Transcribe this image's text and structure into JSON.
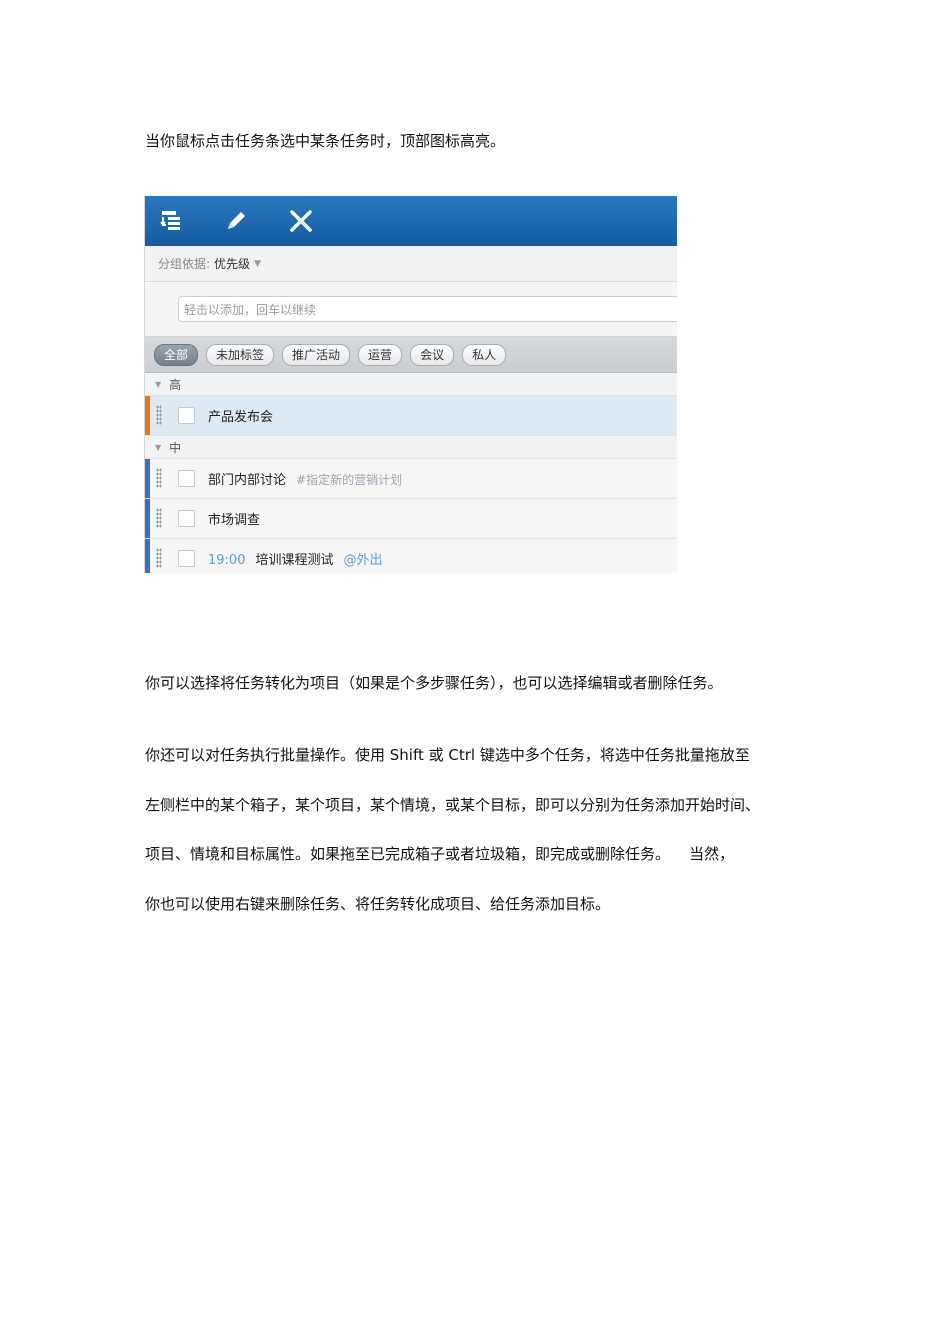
{
  "paragraphs": {
    "p1": "当你鼠标点击任务条选中某条任务时，顶部图标高亮。",
    "p2": "你可以选择将任务转化为项目（如果是个多步骤任务），也可以选择编辑或者删除任务。",
    "p3_l1": "你还可以对任务执行批量操作。使用 Shift 或 Ctrl 键选中多个任务，将选中任务批量拖放至",
    "p3_l2": "左侧栏中的某个箱子，某个项目，某个情境，或某个目标，即可以分别为任务添加开始时间、",
    "p3_l3": "项目、情境和目标属性。如果拖至已完成箱子或者垃圾箱，即完成或删除任务。    当然，",
    "p3_l4": "你也可以使用右键来删除任务、将任务转化成项目、给任务添加目标。"
  },
  "app": {
    "toolbar": {
      "icons": [
        "convert-to-project-icon",
        "edit-pencil-icon",
        "delete-x-icon"
      ]
    },
    "groupby": {
      "label": "分组依据:",
      "value": "优先级"
    },
    "add_input": {
      "placeholder": "轻击以添加，回车以继续"
    },
    "filters": [
      {
        "label": "全部",
        "active": true
      },
      {
        "label": "未加标签",
        "active": false
      },
      {
        "label": "推广活动",
        "active": false
      },
      {
        "label": "运营",
        "active": false
      },
      {
        "label": "会议",
        "active": false
      },
      {
        "label": "私人",
        "active": false
      }
    ],
    "sections": [
      {
        "title": "高",
        "priority_color": "#e07a1a",
        "tasks": [
          {
            "title": "产品发布会",
            "selected": true
          }
        ]
      },
      {
        "title": "中",
        "priority_color": "#3b6fc4",
        "tasks": [
          {
            "title": "部门内部讨论",
            "tag": "#指定新的营销计划"
          },
          {
            "title": "市场调查"
          },
          {
            "time": "19:00",
            "title": "培训课程测试",
            "context": "@外出"
          }
        ]
      }
    ]
  }
}
